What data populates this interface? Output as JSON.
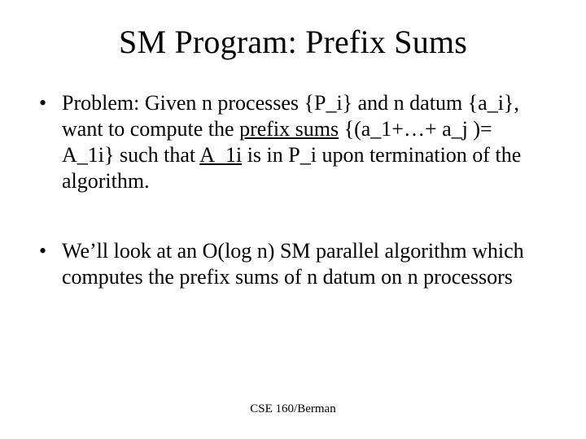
{
  "title": "SM Program: Prefix Sums",
  "bullet1": {
    "p1": "Problem:  Given n processes {P_i} and n datum {a_i}, want to compute the ",
    "p2": "prefix sums",
    "p3": " {(a_1+…+ a_j )= A_1i} such that ",
    "p4": "A_1i",
    "p5": " is in P_i upon termination of the algorithm."
  },
  "bullet2": "We’ll look at an O(log n) SM parallel algorithm which computes the prefix sums of n datum on n processors",
  "footer": "CSE 160/Berman"
}
